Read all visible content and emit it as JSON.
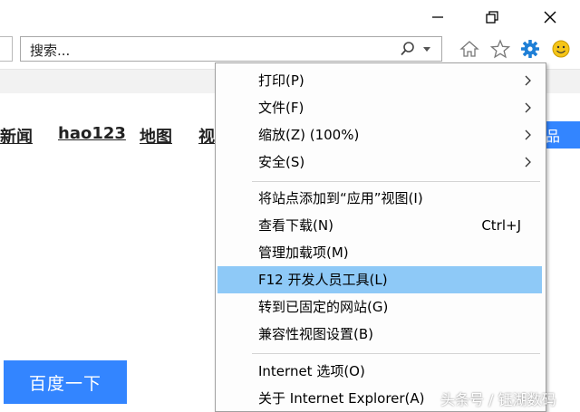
{
  "toolbar": {
    "search_placeholder": "搜索..."
  },
  "nav": {
    "links": [
      "新闻",
      "hao123",
      "地图",
      "视"
    ],
    "more_label": "品"
  },
  "page": {
    "search_button": "百度一下"
  },
  "menu": {
    "items": [
      {
        "label": "打印(P)",
        "submenu": true
      },
      {
        "label": "文件(F)",
        "submenu": true
      },
      {
        "label": "缩放(Z) (100%)",
        "submenu": true
      },
      {
        "label": "安全(S)",
        "submenu": true
      },
      {
        "label": "将站点添加到“应用”视图(I)"
      },
      {
        "label": "查看下载(N)",
        "shortcut": "Ctrl+J"
      },
      {
        "label": "管理加载项(M)"
      },
      {
        "label": "F12 开发人员工具(L)",
        "highlighted": true
      },
      {
        "label": "转到已固定的网站(G)"
      },
      {
        "label": "兼容性视图设置(B)"
      },
      {
        "label": "Internet 选项(O)"
      },
      {
        "label": "关于 Internet Explorer(A)"
      }
    ]
  },
  "watermark": "头条号 / 钰湖数码",
  "colors": {
    "highlight": "#8ec9f7",
    "baidu_blue": "#3385ff",
    "gear_blue": "#1e7fd6",
    "smiley": "#f5c518"
  },
  "icons": [
    "minimize-icon",
    "restore-icon",
    "close-icon",
    "search-icon",
    "dropdown-icon",
    "home-icon",
    "star-icon",
    "gear-icon",
    "smiley-icon",
    "chevron-right-icon"
  ]
}
